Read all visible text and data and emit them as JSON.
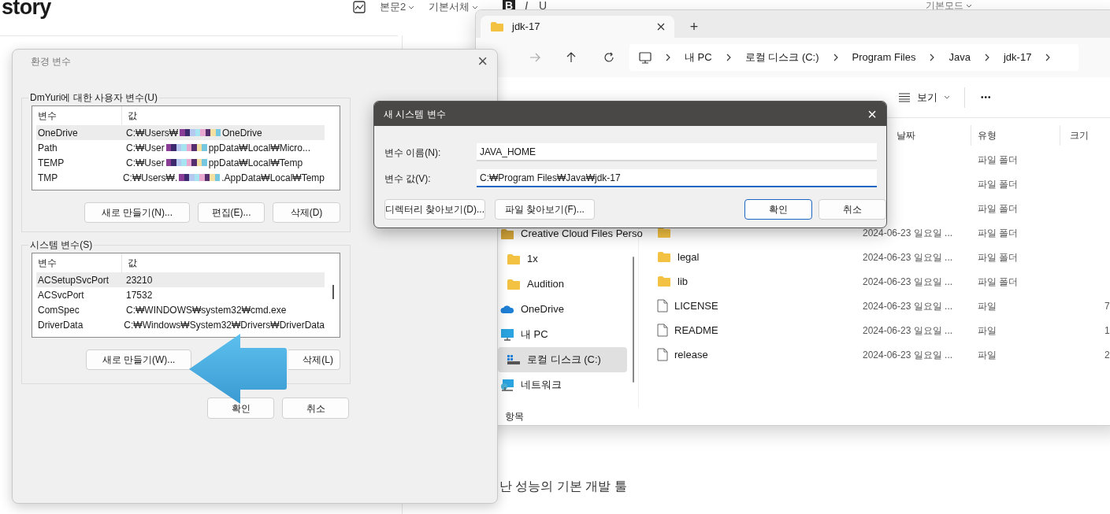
{
  "blog_editor": {
    "logo": "story",
    "format_buttons": [
      "B",
      "I",
      "U"
    ],
    "toolbar": [
      "본문2",
      "기본서체"
    ],
    "mode": "기본모드",
    "body_text": "난 성능의 기본 개발 툴"
  },
  "explorer": {
    "tab_title": "jdk-17",
    "new_tab": "+",
    "breadcrumb": [
      "내 PC",
      "로컬 디스크 (C:)",
      "Program Files",
      "Java",
      "jdk-17"
    ],
    "view_button": "보기",
    "more_button": "•••",
    "columns": [
      "날짜",
      "유형",
      "크기"
    ],
    "sidebar": [
      {
        "label": "Creative Cloud Files Perso",
        "kind": "cc-folder",
        "selected": false,
        "indent": false
      },
      {
        "label": "1x",
        "kind": "folder",
        "selected": false,
        "indent": true
      },
      {
        "label": "Audition",
        "kind": "folder",
        "selected": false,
        "indent": true
      },
      {
        "label": "OneDrive",
        "kind": "cloud",
        "selected": false,
        "indent": false
      },
      {
        "label": "내 PC",
        "kind": "pc",
        "selected": false,
        "indent": false
      },
      {
        "label": "로컬 디스크 (C:)",
        "kind": "drive",
        "selected": true,
        "indent": true
      },
      {
        "label": "네트워크",
        "kind": "network",
        "selected": false,
        "indent": false
      }
    ],
    "rows": [
      {
        "kind": "hidden",
        "type": "파일 폴더"
      },
      {
        "kind": "hidden",
        "type": "파일 폴더"
      },
      {
        "kind": "hidden",
        "type": "파일 폴더"
      },
      {
        "kind": "folder",
        "date": "2024-06-23 일요일 ...",
        "type": "파일 폴더"
      },
      {
        "kind": "folder",
        "name": "legal",
        "date": "2024-06-23 일요일 ...",
        "type": "파일 폴더"
      },
      {
        "kind": "folder",
        "name": "lib",
        "date": "2024-06-23 일요일 ...",
        "type": "파일 폴더"
      },
      {
        "kind": "file",
        "name": "LICENSE",
        "date": "2024-06-23 일요일 ...",
        "type": "파일",
        "size": "7"
      },
      {
        "kind": "file",
        "name": "README",
        "date": "2024-06-23 일요일 ...",
        "type": "파일",
        "size": "1"
      },
      {
        "kind": "file",
        "name": "release",
        "date": "2024-06-23 일요일 ...",
        "type": "파일",
        "size": "2"
      }
    ],
    "status": "항목"
  },
  "env_dialog": {
    "title": "환경 변수",
    "close": "×",
    "user_group": {
      "title": "DmYuri에 대한 사용자 변수(U)",
      "columns": [
        "변수",
        "값"
      ],
      "rows": [
        {
          "name": "OneDrive",
          "value_start": "C:₩Users₩",
          "value_end": "OneDrive",
          "selected": true
        },
        {
          "name": "Path",
          "value_start": "C:₩User",
          "value_end": "ppData₩Local₩Micro...",
          "selected": false
        },
        {
          "name": "TEMP",
          "value_start": "C:₩User",
          "value_end": "ppData₩Local₩Temp",
          "selected": false
        },
        {
          "name": "TMP",
          "value_start": "C:₩Users₩.",
          "value_end": ".AppData₩Local₩Temp",
          "selected": false
        }
      ],
      "buttons": [
        "새로 만들기(N)...",
        "편집(E)...",
        "삭제(D)"
      ]
    },
    "system_group": {
      "title": "시스템 변수(S)",
      "columns": [
        "변수",
        "값"
      ],
      "rows": [
        {
          "name": "ACSetupSvcPort",
          "value": "23210",
          "selected": true
        },
        {
          "name": "ACSvcPort",
          "value": "17532",
          "selected": false
        },
        {
          "name": "ComSpec",
          "value": "C:₩WINDOWS₩system32₩cmd.exe",
          "selected": false
        },
        {
          "name": "DriverData",
          "value": "C:₩Windows₩System32₩Drivers₩DriverData",
          "selected": false
        }
      ],
      "buttons": [
        "새로 만들기(W)...",
        "삭제(L)"
      ]
    },
    "buttons": [
      "확인",
      "취소"
    ]
  },
  "new_var_dialog": {
    "title": "새 시스템 변수",
    "close": "×",
    "fields": [
      {
        "label": "변수 이름(N):",
        "value": "JAVA_HOME",
        "focused": false
      },
      {
        "label": "변수 값(V):",
        "value": "C:₩Program Files₩Java₩jdk-17",
        "focused": true
      }
    ],
    "left_buttons": [
      "디렉터리 찾아보기(D)...",
      "파일 찾아보기(F)..."
    ],
    "buttons": [
      {
        "label": "확인",
        "default": true
      },
      {
        "label": "취소",
        "default": false
      }
    ]
  }
}
